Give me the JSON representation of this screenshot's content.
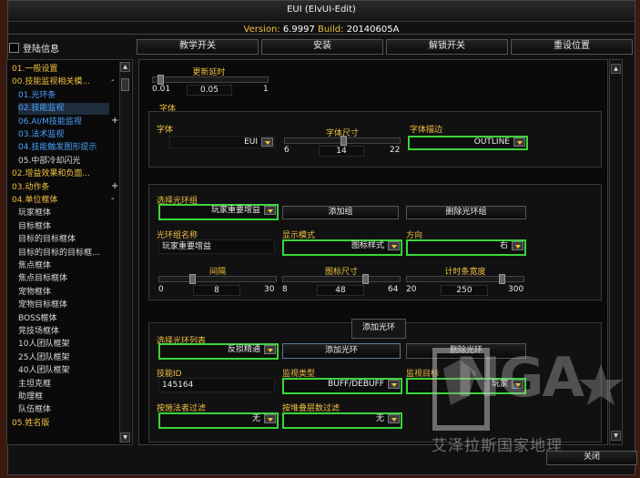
{
  "window": {
    "title": "EUI (ElvUI-Edit)"
  },
  "version": {
    "label": "Version:",
    "version": "6.9997",
    "build_label": "Build:",
    "build": "20140605A"
  },
  "login": {
    "label": "登陆信息"
  },
  "top_buttons": [
    "教学开关",
    "安装",
    "解锁开关",
    "重设位置"
  ],
  "sidebar": {
    "items": [
      {
        "label": "01.一般设置",
        "kind": "top"
      },
      {
        "label": "00.技能监视相关模...",
        "kind": "top",
        "sign": "-"
      },
      {
        "label": "01.光环条",
        "kind": "blue"
      },
      {
        "label": "02.技能监视",
        "kind": "sel"
      },
      {
        "label": "06.AI/M技能监视",
        "kind": "blue",
        "sign": "+"
      },
      {
        "label": "03.法术监视",
        "kind": "blue"
      },
      {
        "label": "04.技能触发图形提示",
        "kind": "blue"
      },
      {
        "label": "05.中部冷却闪光",
        "kind": "sub"
      },
      {
        "label": "02.增益效果和负面...",
        "kind": "top"
      },
      {
        "label": "03.动作条",
        "kind": "top",
        "sign": "+"
      },
      {
        "label": "04.单位框体",
        "kind": "top",
        "sign": "-"
      },
      {
        "label": "玩家框体",
        "kind": "sub"
      },
      {
        "label": "目标框体",
        "kind": "sub"
      },
      {
        "label": "目标的目标框体",
        "kind": "sub"
      },
      {
        "label": "目标的目标的目标框...",
        "kind": "sub"
      },
      {
        "label": "焦点框体",
        "kind": "sub"
      },
      {
        "label": "焦点目标框体",
        "kind": "sub"
      },
      {
        "label": "宠物框体",
        "kind": "sub"
      },
      {
        "label": "宠物目标框体",
        "kind": "sub"
      },
      {
        "label": "BOSS框体",
        "kind": "sub"
      },
      {
        "label": "竞技场框体",
        "kind": "sub"
      },
      {
        "label": "10人团队框架",
        "kind": "sub"
      },
      {
        "label": "25人团队框架",
        "kind": "sub"
      },
      {
        "label": "40人团队框架",
        "kind": "sub"
      },
      {
        "label": "主坦克框",
        "kind": "sub"
      },
      {
        "label": "助理框",
        "kind": "sub"
      },
      {
        "label": "队伍框体",
        "kind": "sub"
      },
      {
        "label": "05.姓名版",
        "kind": "top"
      }
    ]
  },
  "update_delay": {
    "label": "更新延时",
    "min": "0.01",
    "max": "1",
    "value": "0.05",
    "fraction": 0.04
  },
  "font_group": {
    "title": "字体",
    "font_label": "字体",
    "font_value": "EUI",
    "size_label": "字体尺寸",
    "size_min": "6",
    "size_max": "22",
    "size_value": "14",
    "size_fraction": 0.5,
    "outline_label": "字体描边",
    "outline_value": "OUTLINE"
  },
  "aura_group": {
    "select_label": "选择光环组",
    "select_value": "玩家重要增益",
    "add_group": "添加组",
    "delete_group": "删除光环组",
    "name_label": "光环组名称",
    "name_value": "玩家重要增益",
    "mode_label": "显示模式",
    "mode_value": "图标样式",
    "dir_label": "方向",
    "dir_value": "右",
    "spacing_label": "间隔",
    "spacing_min": "0",
    "spacing_max": "30",
    "spacing_value": "8",
    "spacing_fraction": 0.27,
    "icon_label": "图标尺寸",
    "icon_min": "8",
    "icon_max": "64",
    "icon_value": "48",
    "icon_fraction": 0.71,
    "bar_label": "计时条宽度",
    "bar_min": "20",
    "bar_max": "300",
    "bar_value": "250",
    "bar_fraction": 0.82
  },
  "aura_list": {
    "tooltip": "添加光环",
    "select_label": "选择光环列表",
    "select_value": "反损精通",
    "add_aura": "添加光环",
    "delete_aura": "删除光环",
    "spellid_label": "技能ID",
    "spellid_value": "145164",
    "type_label": "监视类型",
    "type_value": "BUFF/DEBUFF",
    "target_label": "监视目标",
    "target_value": "玩家",
    "caster_label": "按施法者过滤",
    "caster_value": "无",
    "stack_label": "按堆叠层数过滤",
    "stack_value": "无"
  },
  "close": {
    "label": "关闭"
  },
  "watermark": {
    "text": "NGA",
    "subtitle": "艾泽拉斯国家地理"
  }
}
